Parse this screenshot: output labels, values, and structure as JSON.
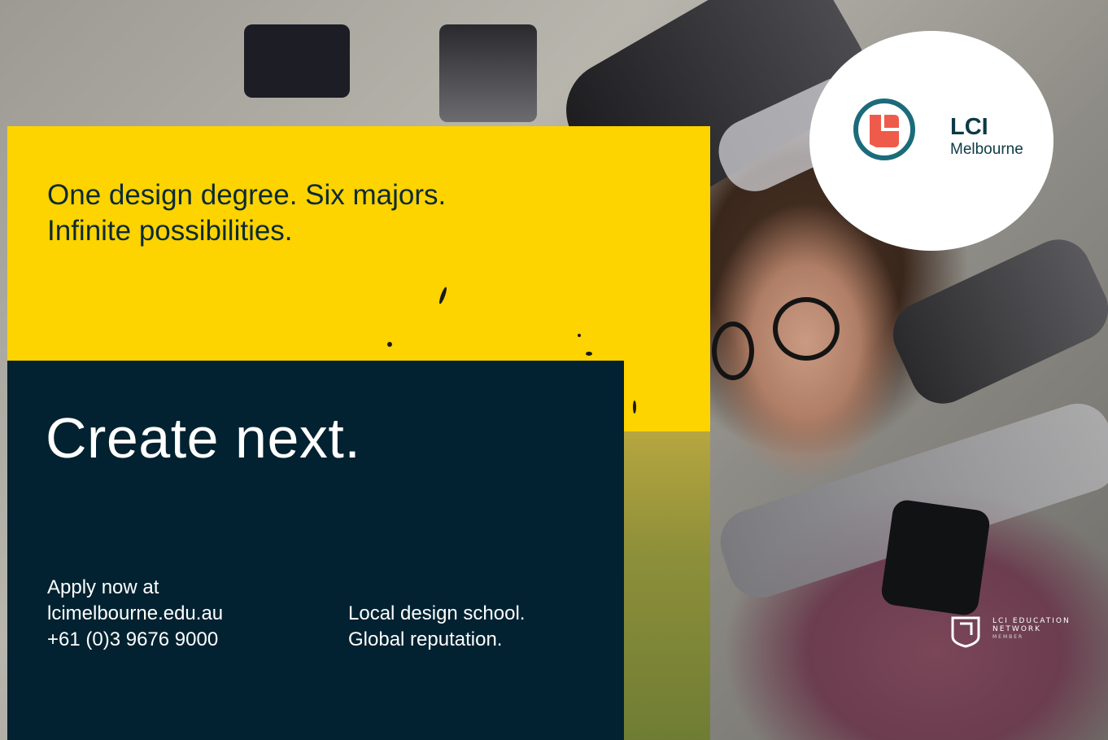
{
  "headline": [
    "One design degree. Six majors.",
    "Infinite possibilities."
  ],
  "tagline": "Create next.",
  "contact": [
    "Apply now at",
    "lcimelbourne.edu.au",
    "+61 (0)3 9676 9000"
  ],
  "slogan": [
    "Local design school.",
    "Global reputation."
  ],
  "logo": {
    "name": "LCI",
    "city": "Melbourne",
    "icon": "lci-logo-icon"
  },
  "network": {
    "line1": "LCI EDUCATION",
    "line2": "NETWORK",
    "line3": "MEMBER",
    "icon": "network-shield-icon"
  },
  "colors": {
    "yellow": "#fdd300",
    "navy": "#022231",
    "logo_teal": "#1c6b7a",
    "logo_coral": "#ef5b4a"
  }
}
